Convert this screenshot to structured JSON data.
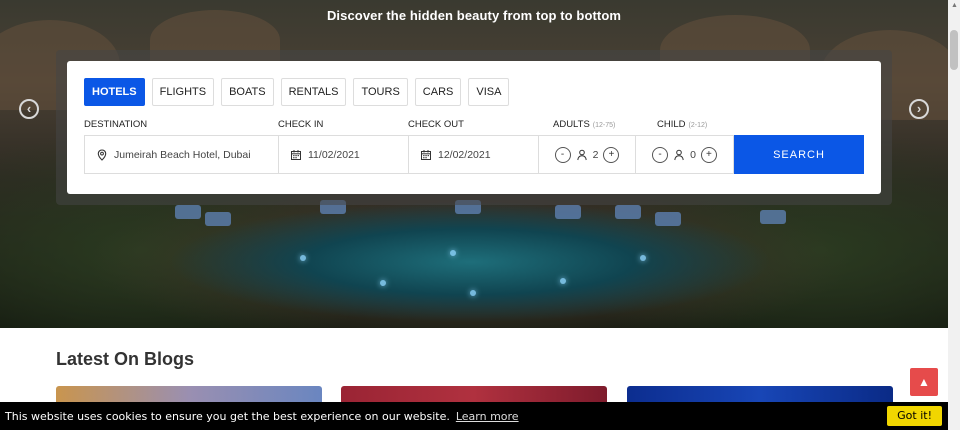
{
  "hero": {
    "subtitle": "Discover the hidden beauty from top to bottom"
  },
  "search": {
    "tabs": [
      {
        "label": "HOTELS",
        "active": true
      },
      {
        "label": "FLIGHTS",
        "active": false
      },
      {
        "label": "BOATS",
        "active": false
      },
      {
        "label": "RENTALS",
        "active": false
      },
      {
        "label": "TOURS",
        "active": false
      },
      {
        "label": "CARS",
        "active": false
      },
      {
        "label": "VISA",
        "active": false
      }
    ],
    "destination": {
      "label": "DESTINATION",
      "value": "Jumeirah Beach Hotel, Dubai",
      "icon": "map-pin-icon"
    },
    "check_in": {
      "label": "CHECK IN",
      "value": "11/02/2021",
      "icon": "calendar-icon"
    },
    "check_out": {
      "label": "CHECK OUT",
      "value": "12/02/2021",
      "icon": "calendar-icon"
    },
    "adults": {
      "label": "ADULTS",
      "hint": "(12-75)",
      "value": "2",
      "minus": "-",
      "plus": "+"
    },
    "child": {
      "label": "CHILD",
      "hint": "(2-12)",
      "value": "0",
      "minus": "-",
      "plus": "+"
    },
    "submit_label": "SEARCH"
  },
  "blogs": {
    "title": "Latest On Blogs"
  },
  "cookie": {
    "message": "This website uses cookies to ensure you get the best experience on our website.",
    "learn_more": "Learn more",
    "accept": "Got it!"
  },
  "colors": {
    "primary": "#0b57e6",
    "to_top": "#e64b4b",
    "cookie_button": "#f1d600"
  }
}
